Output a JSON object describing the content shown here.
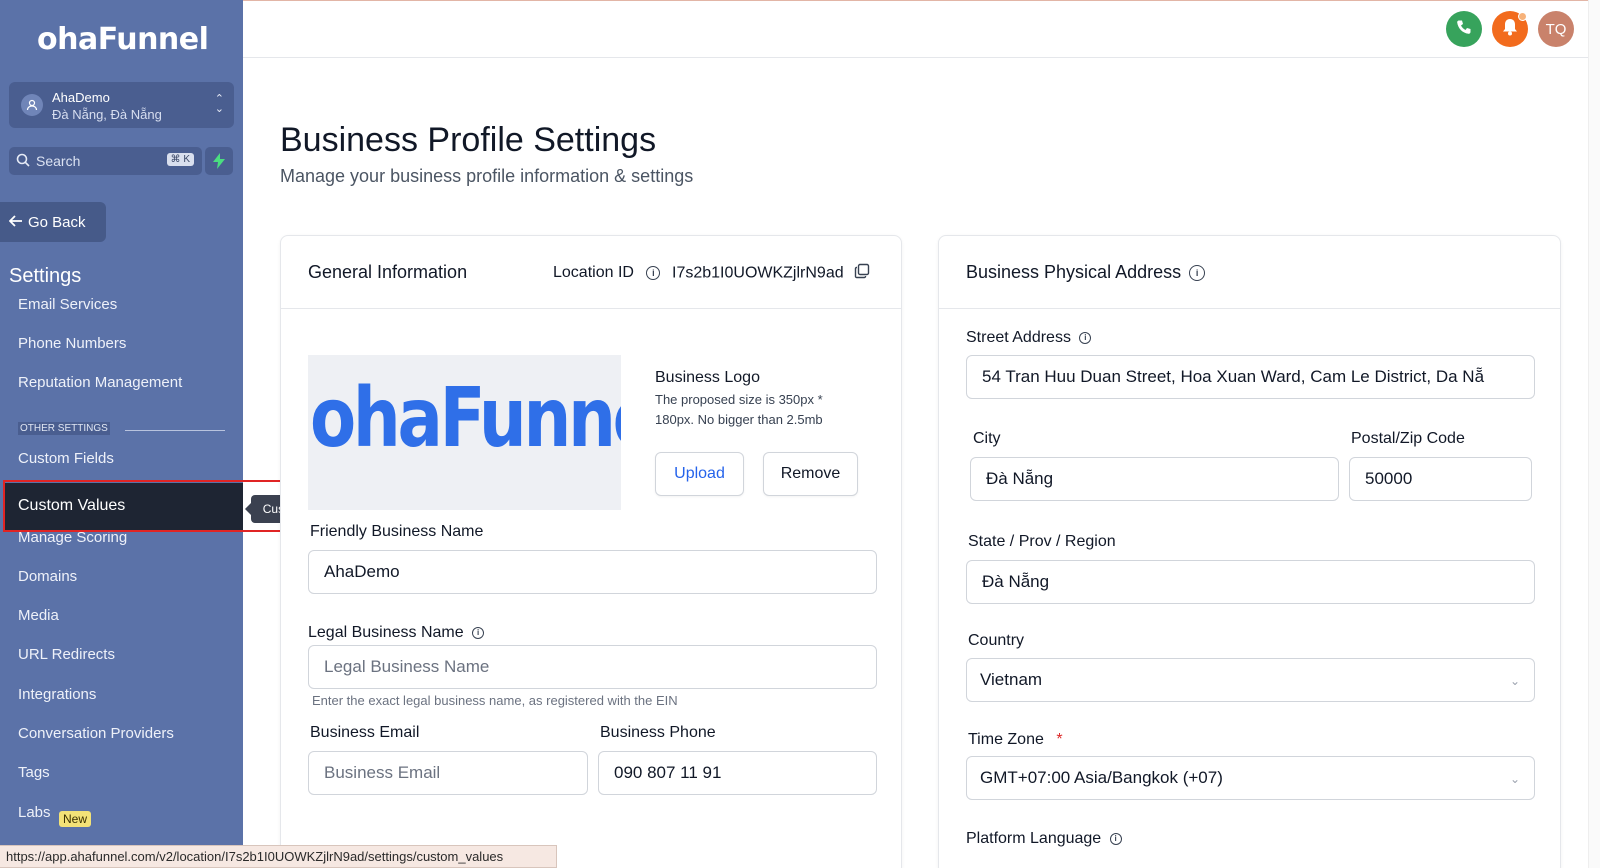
{
  "brand": {
    "logo_text": "ohaFunnel"
  },
  "location": {
    "name": "AhaDemo",
    "region": "Đà Nẵng, Đà Nẵng"
  },
  "search": {
    "placeholder": "Search",
    "shortcut": "⌘ K"
  },
  "sidebar": {
    "go_back": "Go Back",
    "section_title": "Settings",
    "items_top": [
      "Email Services",
      "Phone Numbers",
      "Reputation Management"
    ],
    "other_label": "OTHER SETTINGS",
    "items": {
      "custom_fields": "Custom Fields",
      "custom_values": "Custom Values",
      "manage_scoring": "Manage Scoring",
      "domains": "Domains",
      "media": "Media",
      "url_redirects": "URL Redirects",
      "integrations": "Integrations",
      "conversation_providers": "Conversation Providers",
      "tags": "Tags",
      "labs": "Labs"
    },
    "labs_badge": "New",
    "tooltip": "Custom Values"
  },
  "statusbar_url": "https://app.ahafunnel.com/v2/location/I7s2b1I0UOWKZjlrN9ad/settings/custom_values",
  "topbar": {
    "user_initials": "TQ"
  },
  "page": {
    "title": "Business Profile Settings",
    "subtitle": "Manage your business profile information & settings"
  },
  "general": {
    "title": "General Information",
    "location_id_label": "Location ID",
    "location_id_value": "I7s2b1I0UOWKZjlrN9ad",
    "logo_label": "Business Logo",
    "logo_note": "The proposed size is 350px * 180px. No bigger than 2.5mb",
    "logo_preview_text": "ohaFunnel",
    "upload": "Upload",
    "remove": "Remove",
    "friendly_name_label": "Friendly Business Name",
    "friendly_name_value": "AhaDemo",
    "legal_name_label": "Legal Business Name",
    "legal_name_placeholder": "Legal Business Name",
    "legal_name_hint": "Enter the exact legal business name, as registered with the EIN",
    "email_label": "Business Email",
    "email_placeholder": "Business Email",
    "phone_label": "Business Phone",
    "phone_value": "090 807 11 91"
  },
  "address": {
    "title": "Business Physical Address",
    "street_label": "Street Address",
    "street_value": "54 Tran Huu Duan Street, Hoa Xuan Ward, Cam Le District, Da Nẵ",
    "city_label": "City",
    "city_value": "Đà Nẵng",
    "zip_label": "Postal/Zip Code",
    "zip_value": "50000",
    "state_label": "State / Prov / Region",
    "state_value": "Đà Nẵng",
    "country_label": "Country",
    "country_value": "Vietnam",
    "timezone_label": "Time Zone",
    "timezone_value": "GMT+07:00 Asia/Bangkok (+07)",
    "language_label": "Platform Language"
  },
  "colors": {
    "sidebar_bg": "#5b72a8",
    "active_item_bg": "#1e2533",
    "highlight_outline": "#e02424",
    "primary_blue": "#2563eb",
    "phone_green": "#37a35c",
    "bell_orange": "#f26b1d"
  },
  "icons": [
    "user-location-icon",
    "chevron-updown-icon",
    "search-icon",
    "bolt-icon",
    "arrow-left-icon",
    "phone-icon",
    "bell-icon",
    "info-icon",
    "copy-icon",
    "chevron-down-icon"
  ]
}
